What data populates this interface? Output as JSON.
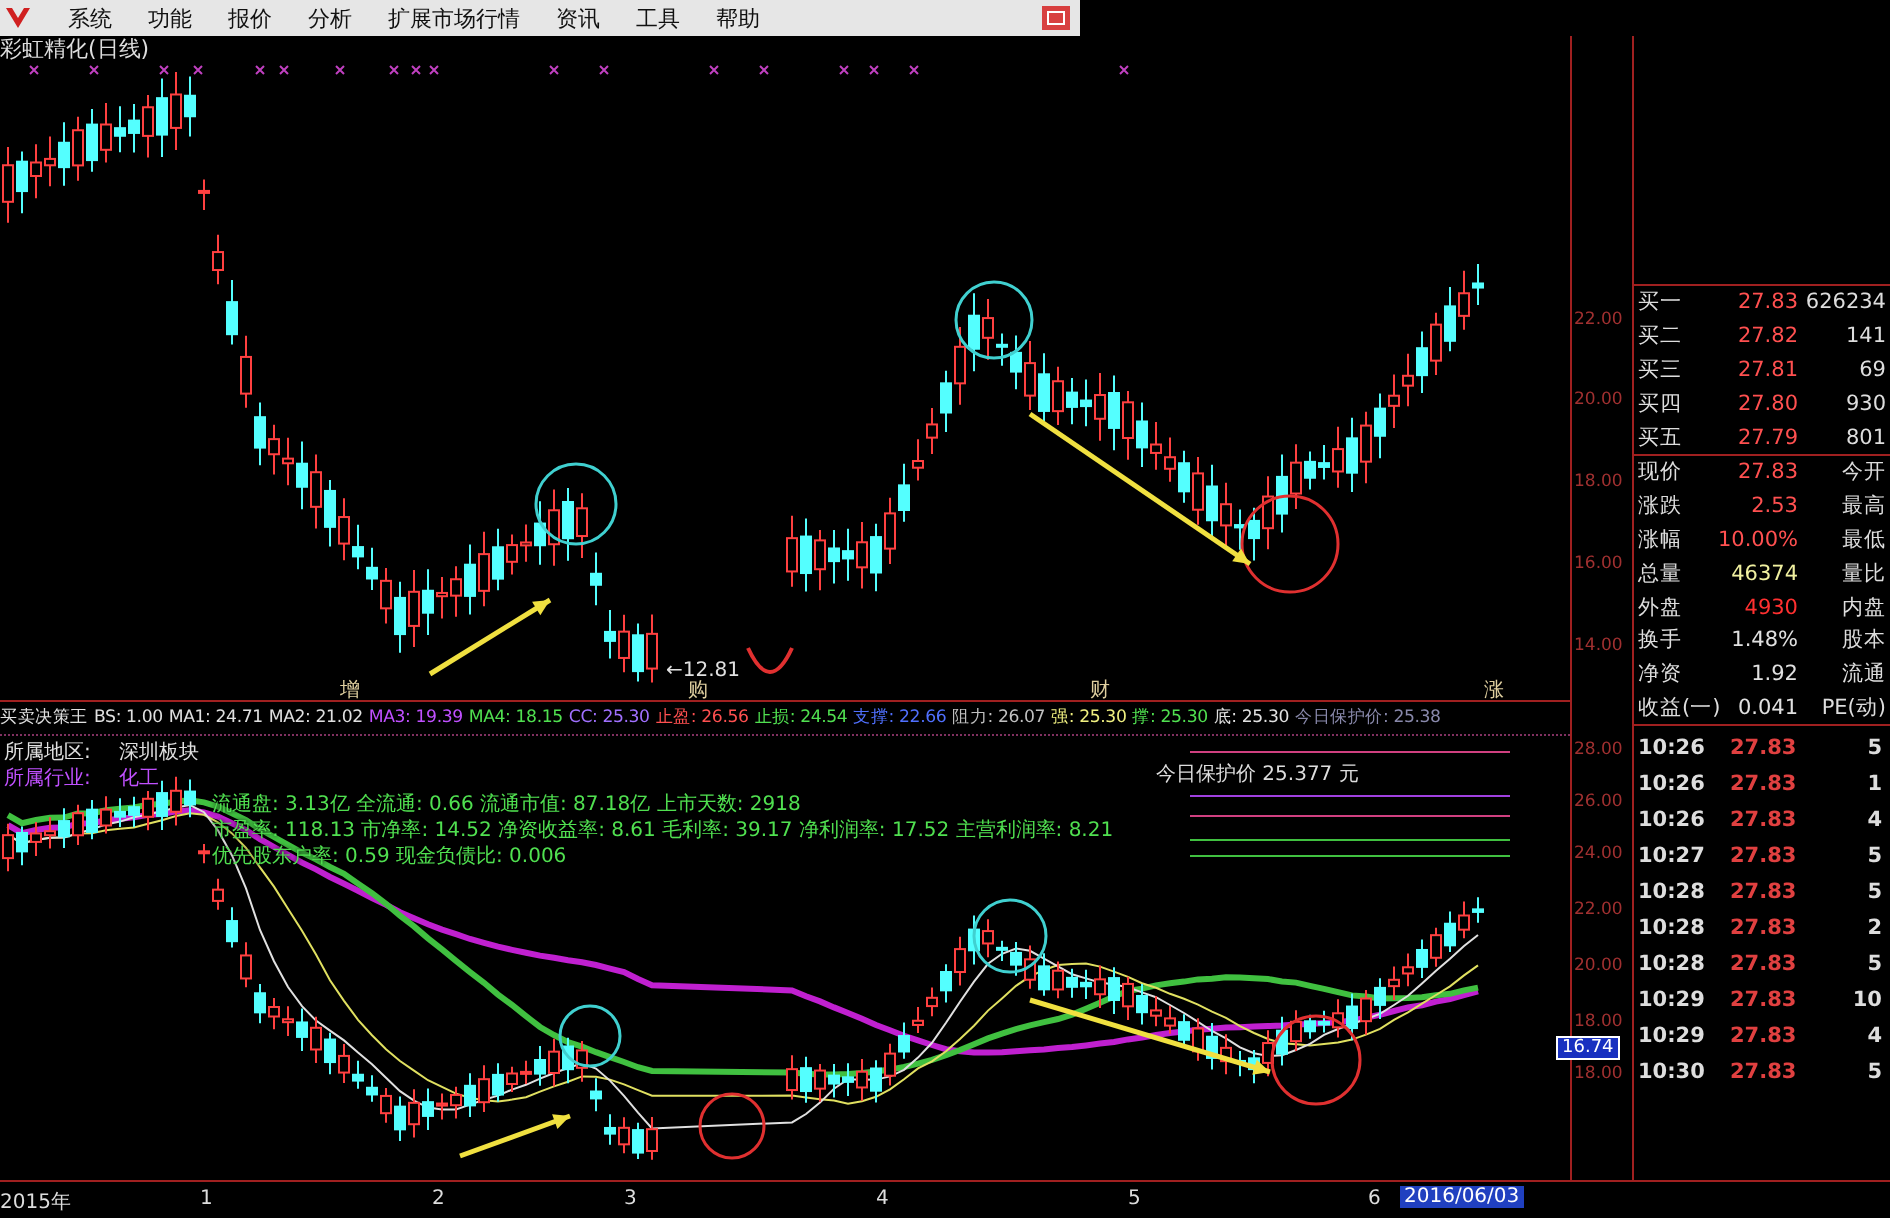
{
  "menu": [
    "系统",
    "功能",
    "报价",
    "分析",
    "扩展市场行情",
    "资讯",
    "工具",
    "帮助"
  ],
  "chart_title": "彩虹精化(日线)",
  "upper_markers": [
    "增",
    "购",
    "财",
    "涨"
  ],
  "low_label": "←12.81",
  "upper_axis": [
    "22.00",
    "20.00",
    "18.00",
    "16.00",
    "14.00"
  ],
  "indicator": [
    {
      "text": "买卖决策王",
      "color": "#e0e0e0"
    },
    {
      "text": "BS: 1.00",
      "color": "#e0e0e0"
    },
    {
      "text": "MA1: 24.71",
      "color": "#e0e0e0"
    },
    {
      "text": "MA2: 21.02",
      "color": "#e0e0e0"
    },
    {
      "text": "MA3: 19.39",
      "color": "#c050ff"
    },
    {
      "text": "MA4: 18.15",
      "color": "#50e050"
    },
    {
      "text": "CC: 25.30",
      "color": "#a070ff"
    },
    {
      "text": "止盈: 26.56",
      "color": "#ff5050"
    },
    {
      "text": "止损: 24.54",
      "color": "#50e050"
    },
    {
      "text": "支撑: 22.66",
      "color": "#5070ff"
    },
    {
      "text": "阻力: 26.07",
      "color": "#c0c0c0"
    },
    {
      "text": "强: 25.30",
      "color": "#f0f080"
    },
    {
      "text": "撑: 25.30",
      "color": "#50e050"
    },
    {
      "text": "底: 25.30",
      "color": "#e0e0e0"
    },
    {
      "text": "今日保护价: 25.38",
      "color": "#8888aa"
    }
  ],
  "info_lines": [
    {
      "label": "所属地区:",
      "value": "深圳板块",
      "color": "#e0e0e0"
    },
    {
      "label": "所属行业:",
      "value": "化工",
      "color": "#c050ff"
    },
    {
      "label": "流通盘: 3.13亿 全流通: 0.66 流通市值: 87.18亿 上市天数: 2918",
      "color": "#50e050"
    },
    {
      "label": "市盈率: 118.13 市净率: 14.52 净资收益率: 8.61 毛利率: 39.17 净利润率: 17.52 主营利润率: 8.21",
      "color": "#50e050"
    },
    {
      "label": "优先股东户率: 0.59 现金负债比: 0.006",
      "color": "#50e050"
    }
  ],
  "protect_price": "今日保护价 25.377 元",
  "lower_axis": [
    "28.00",
    "26.00",
    "24.00",
    "22.00",
    "20.00",
    "18.00"
  ],
  "lower_current": "16.74",
  "lower_bottom_tick": "18.00",
  "quote_rows": [
    {
      "label": "买一",
      "value": "27.83",
      "color": "#ff5050",
      "extra": "626234"
    },
    {
      "label": "买二",
      "value": "27.82",
      "color": "#ff5050",
      "extra": "141"
    },
    {
      "label": "买三",
      "value": "27.81",
      "color": "#ff5050",
      "extra": "69"
    },
    {
      "label": "买四",
      "value": "27.80",
      "color": "#ff5050",
      "extra": "930"
    },
    {
      "label": "买五",
      "value": "27.79",
      "color": "#ff5050",
      "extra": "801"
    },
    {
      "label": "现价",
      "value": "27.83",
      "color": "#ff5050",
      "extra": "今开"
    },
    {
      "label": "涨跌",
      "value": "2.53",
      "color": "#ff5050",
      "extra": "最高"
    },
    {
      "label": "涨幅",
      "value": "10.00%",
      "color": "#ff5050",
      "extra": "最低"
    },
    {
      "label": "总量",
      "value": "46374",
      "color": "#f0f0a0",
      "extra": "量比"
    },
    {
      "label": "外盘",
      "value": "4930",
      "color": "#ff3030",
      "extra": "内盘"
    },
    {
      "label": "换手",
      "value": "1.48%",
      "color": "#e0e0e0",
      "extra": "股本"
    },
    {
      "label": "净资",
      "value": "1.92",
      "color": "#e0e0e0",
      "extra": "流通"
    },
    {
      "label": "收益(一)",
      "value": "0.041",
      "color": "#e0e0e0",
      "extra": "PE(动)"
    }
  ],
  "ticks": [
    {
      "time": "10:26",
      "price": "27.83",
      "volume": "5"
    },
    {
      "time": "10:26",
      "price": "27.83",
      "volume": "1"
    },
    {
      "time": "10:26",
      "price": "27.83",
      "volume": "4"
    },
    {
      "time": "10:27",
      "price": "27.83",
      "volume": "5"
    },
    {
      "time": "10:28",
      "price": "27.83",
      "volume": "5"
    },
    {
      "time": "10:28",
      "price": "27.83",
      "volume": "2"
    },
    {
      "time": "10:28",
      "price": "27.83",
      "volume": "5"
    },
    {
      "time": "10:29",
      "price": "27.83",
      "volume": "10"
    },
    {
      "time": "10:29",
      "price": "27.83",
      "volume": "4"
    },
    {
      "time": "10:30",
      "price": "27.83",
      "volume": "5"
    }
  ],
  "date_axis": [
    "2015年",
    "1",
    "2",
    "3",
    "4",
    "5",
    "6"
  ],
  "date_end": "2016/06/03"
}
